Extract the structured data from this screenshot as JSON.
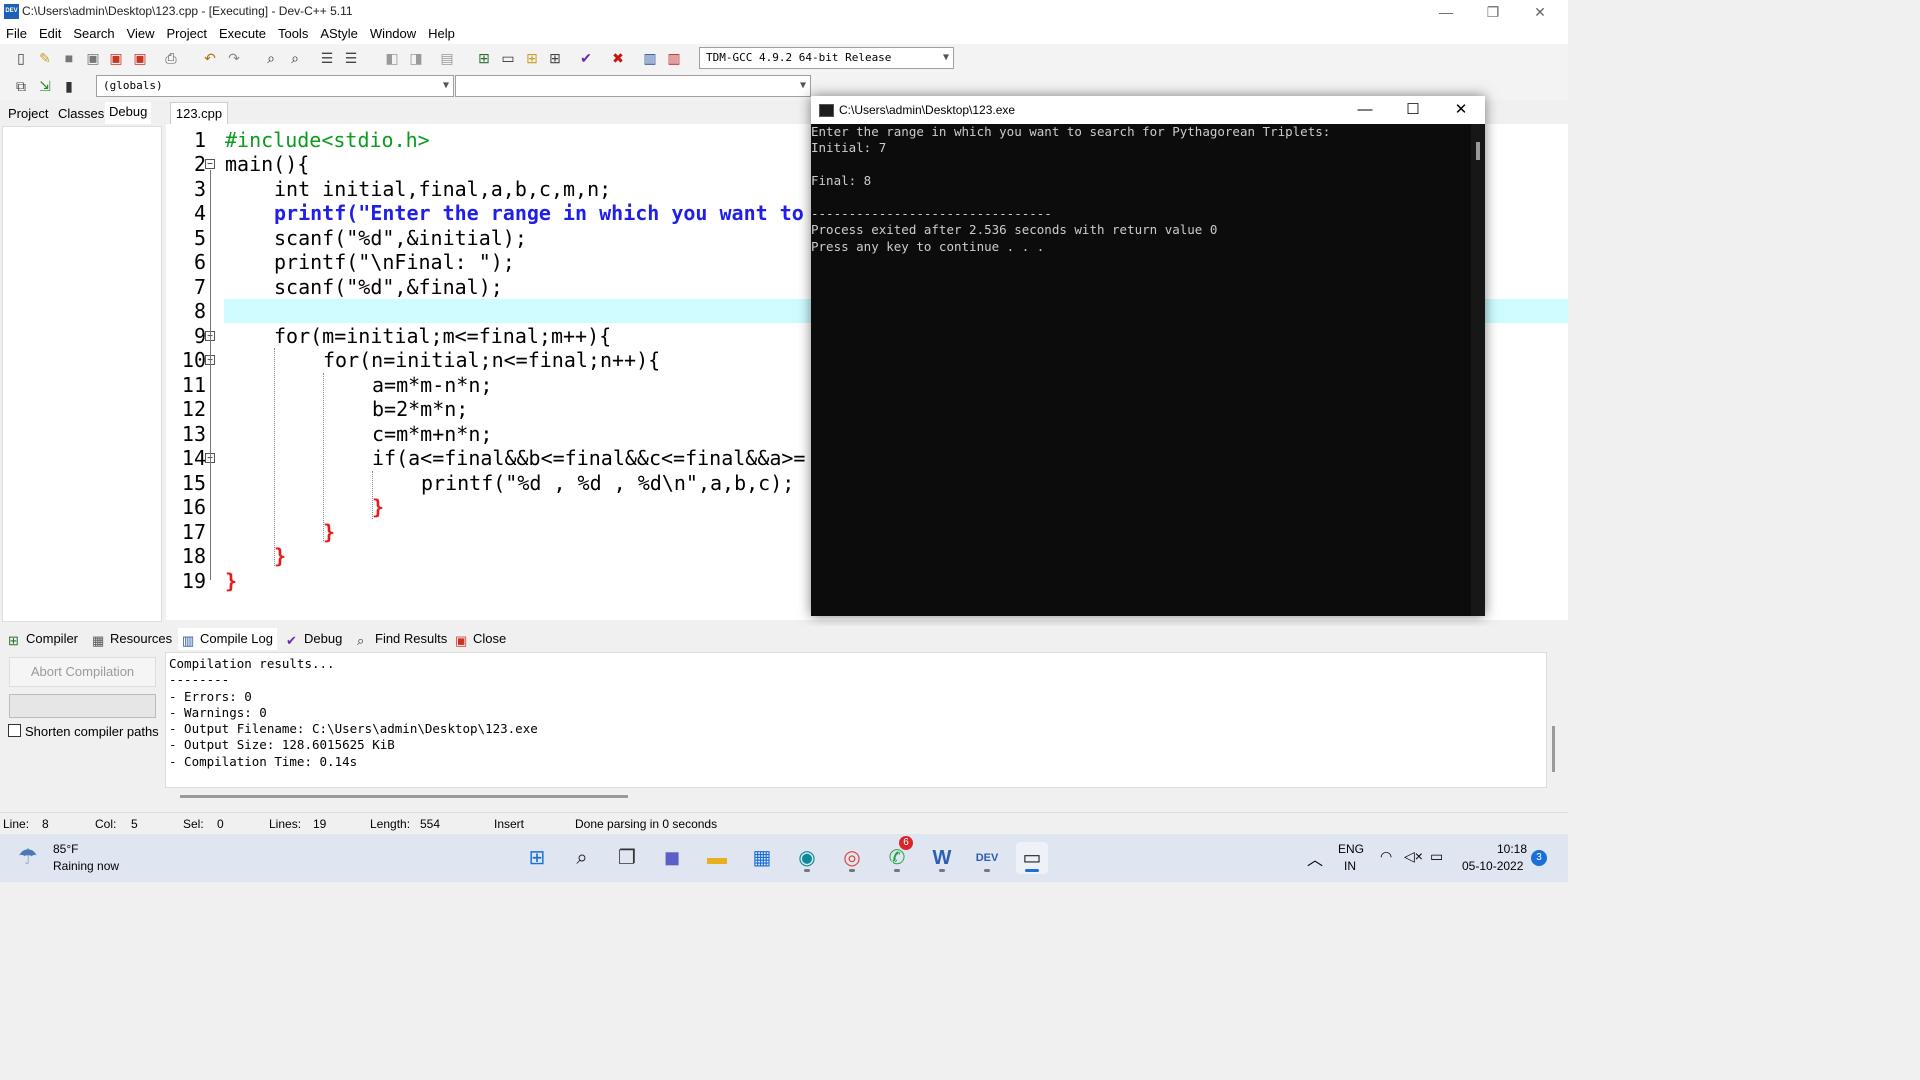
{
  "window": {
    "title": "C:\\Users\\admin\\Desktop\\123.cpp - [Executing] - Dev-C++ 5.11",
    "app_icon_text": "DEV",
    "controls": [
      "—",
      "❐",
      "✕"
    ]
  },
  "menu": [
    "File",
    "Edit",
    "Search",
    "View",
    "Project",
    "Execute",
    "Tools",
    "AStyle",
    "Window",
    "Help"
  ],
  "toolbar": {
    "compiler_select": "TDM-GCC 4.9.2 64-bit Release",
    "globals_select": "(globals)",
    "member_select": ""
  },
  "left_panel": {
    "tabs": [
      "Project",
      "Classes",
      "Debug"
    ]
  },
  "editor": {
    "tab": "123.cpp",
    "line_numbers": [
      "1",
      "2",
      "3",
      "4",
      "5",
      "6",
      "7",
      "8",
      "9",
      "10",
      "11",
      "12",
      "13",
      "14",
      "15",
      "16",
      "17",
      "18",
      "19"
    ]
  },
  "code_lines": [
    "#include<stdio.h>",
    "main(){",
    "int initial,final,a,b,c,m,n;",
    "printf(\"Enter the range in which you want to",
    "scanf(\"%d\",&initial);",
    "printf(\"\\nFinal: \");",
    "scanf(\"%d\",&final);",
    "",
    "for(m=initial;m<=final;m++){",
    "for(n=initial;n<=final;n++){",
    "a=m*m-n*n;",
    "b=2*m*n;",
    "c=m*m+n*n;",
    "if(a<=final&&b<=final&&c<=final&&a>=",
    "printf(\"%d , %d , %d\\n\",a,b,c);",
    "}",
    "}",
    "}",
    "}"
  ],
  "console": {
    "title": "C:\\Users\\admin\\Desktop\\123.exe",
    "controls": [
      "—",
      "☐",
      "✕"
    ],
    "output": "Enter the range in which you want to search for Pythagorean Triplets:\nInitial: 7\n\nFinal: 8\n\n--------------------------------\nProcess exited after 2.536 seconds with return value 0\nPress any key to continue . . ."
  },
  "bottom_tabs": [
    "Compiler",
    "Resources",
    "Compile Log",
    "Debug",
    "Find Results",
    "Close"
  ],
  "compile_panel": {
    "abort_button": "Abort Compilation",
    "shorten_paths_label": "Shorten compiler paths",
    "shorten_paths_checked": false,
    "log": "Compilation results...\n--------\n- Errors: 0\n- Warnings: 0\n- Output Filename: C:\\Users\\admin\\Desktop\\123.exe\n- Output Size: 128.6015625 KiB\n- Compilation Time: 0.14s"
  },
  "status": {
    "line_label": "Line:",
    "line_value": "8",
    "col_label": "Col:",
    "col_value": "5",
    "sel_label": "Sel:",
    "sel_value": "0",
    "lines_label": "Lines:",
    "lines_value": "19",
    "length_label": "Length:",
    "length_value": "554",
    "mode": "Insert",
    "message": "Done parsing in 0 seconds"
  },
  "taskbar": {
    "weather_temp": "85°F",
    "weather_desc": "Raining now",
    "whatsapp_badge": "6",
    "lang_top": "ENG",
    "lang_bottom": "IN",
    "time": "10:18",
    "date": "05-10-2022",
    "notif_count": "3"
  },
  "colors": {
    "current_line": "#cffcff",
    "string": "#1f1fe8",
    "symbol": "#e81b1b",
    "preprocessor": "#0b9b1f",
    "number": "#8a1ae0"
  }
}
